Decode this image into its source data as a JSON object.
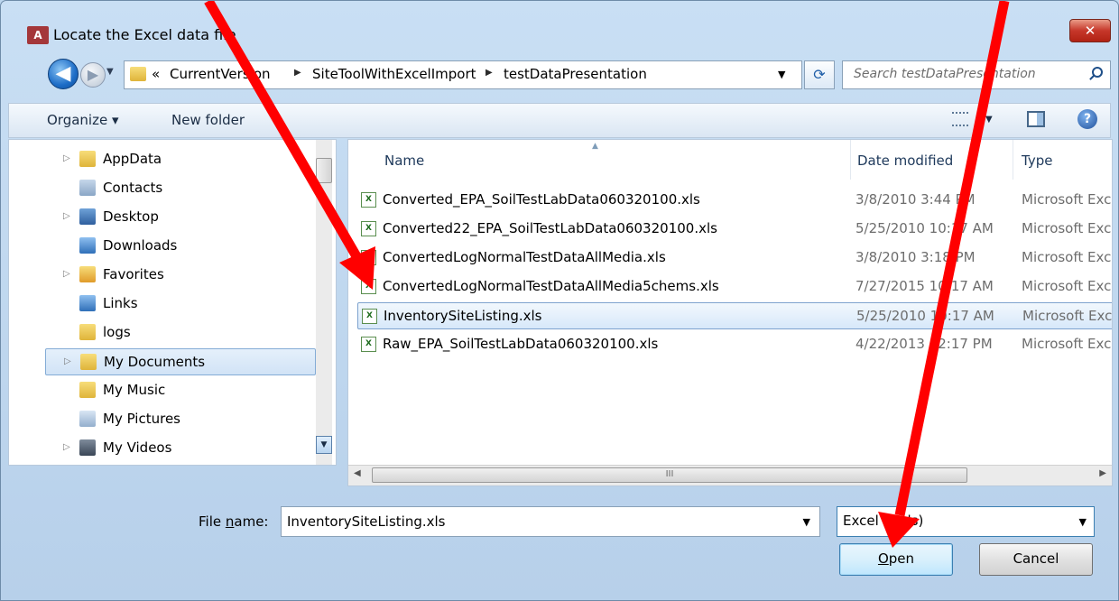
{
  "window": {
    "app_icon": "A",
    "title": "Locate the Excel data file",
    "close_glyph": "✕"
  },
  "nav": {
    "back_glyph": "◀",
    "forward_glyph": "▶",
    "path_overflow": "«",
    "breadcrumbs": [
      "CurrentVersion",
      "SiteToolWithExcelImport",
      "testDataPresentation"
    ],
    "search_placeholder": "Search testDataPresentation"
  },
  "toolbar": {
    "organize_label": "Organize ▾",
    "new_folder_label": "New folder"
  },
  "tree": {
    "items": [
      {
        "label": "AppData",
        "expandable": true,
        "icon": "folder-icon"
      },
      {
        "label": "Contacts",
        "expandable": false,
        "icon": "contacts-icon"
      },
      {
        "label": "Desktop",
        "expandable": true,
        "icon": "desktop-icon"
      },
      {
        "label": "Downloads",
        "expandable": false,
        "icon": "downloads-icon"
      },
      {
        "label": "Favorites",
        "expandable": true,
        "icon": "favorites-icon"
      },
      {
        "label": "Links",
        "expandable": false,
        "icon": "links-icon"
      },
      {
        "label": "logs",
        "expandable": false,
        "icon": "folder-icon"
      },
      {
        "label": "My Documents",
        "expandable": true,
        "icon": "documents-icon",
        "selected": true
      },
      {
        "label": "My Music",
        "expandable": false,
        "icon": "music-icon"
      },
      {
        "label": "My Pictures",
        "expandable": false,
        "icon": "pictures-icon"
      },
      {
        "label": "My Videos",
        "expandable": true,
        "icon": "videos-icon"
      }
    ]
  },
  "files": {
    "columns": {
      "name": "Name",
      "date": "Date modified",
      "type": "Type"
    },
    "rows": [
      {
        "name": "Converted_EPA_SoilTestLabData060320100.xls",
        "date": "3/8/2010 3:44 PM",
        "type": "Microsoft Excel"
      },
      {
        "name": "Converted22_EPA_SoilTestLabData060320100.xls",
        "date": "5/25/2010 10:17 AM",
        "type": "Microsoft Excel"
      },
      {
        "name": "ConvertedLogNormalTestDataAllMedia.xls",
        "date": "3/8/2010 3:18 PM",
        "type": "Microsoft Excel"
      },
      {
        "name": "ConvertedLogNormalTestDataAllMedia5chems.xls",
        "date": "7/27/2015 10:17 AM",
        "type": "Microsoft Excel"
      },
      {
        "name": "InventorySiteListing.xls",
        "date": "5/25/2010 10:17 AM",
        "type": "Microsoft Excel",
        "selected": true
      },
      {
        "name": "Raw_EPA_SoilTestLabData060320100.xls",
        "date": "4/22/2013 12:17 PM",
        "type": "Microsoft Excel"
      }
    ],
    "hscroll_grip": "III"
  },
  "footer": {
    "file_name_label_pre": "File ",
    "file_name_label_accel": "n",
    "file_name_label_post": "ame:",
    "file_name_value": "InventorySiteListing.xls",
    "filter_value": "Excel (*.xls)",
    "open_accel": "O",
    "open_rest": "pen",
    "cancel_label": "Cancel"
  },
  "annotations": {
    "arrow_color": "#ff0000"
  }
}
